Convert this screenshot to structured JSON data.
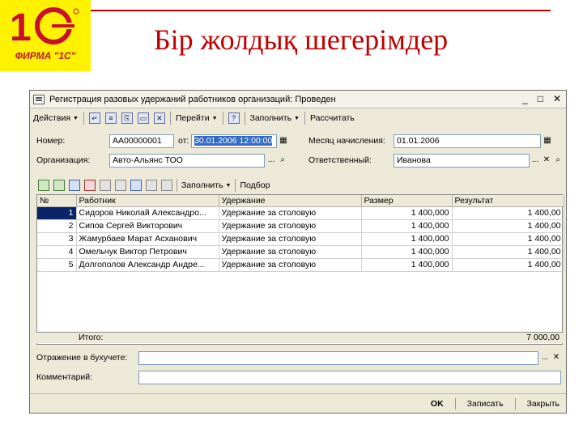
{
  "slide": {
    "brand": "ФИРМА \"1С\"",
    "title": "Бір жолдық шегерімдер"
  },
  "window": {
    "title": "Регистрация разовых удержаний работников организаций: Проведен",
    "controls": [
      "_",
      "□",
      "✕"
    ]
  },
  "toolbar": {
    "actions": "Действия",
    "goto": "Перейти",
    "help": "?",
    "fill": "Заполнить",
    "calculate": "Рассчитать"
  },
  "form": {
    "number_label": "Номер:",
    "number": "АА00000001",
    "from_label": "от:",
    "date": "30.01.2006 12:00:00",
    "month_label": "Месяц начисления:",
    "month": "01.01.2006",
    "org_label": "Организация:",
    "org": "Авто-Альянс ТОО",
    "resp_label": "Ответственный:",
    "resp": "Иванова"
  },
  "table_toolbar": {
    "fill": "Заполнить",
    "pick": "Подбор"
  },
  "table": {
    "columns": [
      "№",
      "Работник",
      "Удержание",
      "Размер",
      "Результат"
    ],
    "rows": [
      {
        "n": "1",
        "employee": "Сидоров Николай Александро...",
        "deduction": "Удержание за столовую",
        "size": "1 400,000",
        "result": "1 400,00"
      },
      {
        "n": "2",
        "employee": "Сипов Сергей Викторович",
        "deduction": "Удержание за столовую",
        "size": "1 400,000",
        "result": "1 400,00"
      },
      {
        "n": "3",
        "employee": "Жамурбаев Марат Асханович",
        "deduction": "Удержание за столовую",
        "size": "1 400,000",
        "result": "1 400,00"
      },
      {
        "n": "4",
        "employee": "Омельчук Виктор Петрович",
        "deduction": "Удержание за столовую",
        "size": "1 400,000",
        "result": "1 400,00"
      },
      {
        "n": "5",
        "employee": "Долгополов Александр Андре...",
        "deduction": "Удержание за столовую",
        "size": "1 400,000",
        "result": "1 400,00"
      }
    ],
    "total_label": "Итого:",
    "total": "7 000,00"
  },
  "footer": {
    "accounting_label": "Отражение в бухучете:",
    "comment_label": "Комментарий:"
  },
  "buttons": {
    "ok": "OK",
    "save": "Записать",
    "close": "Закрыть"
  }
}
